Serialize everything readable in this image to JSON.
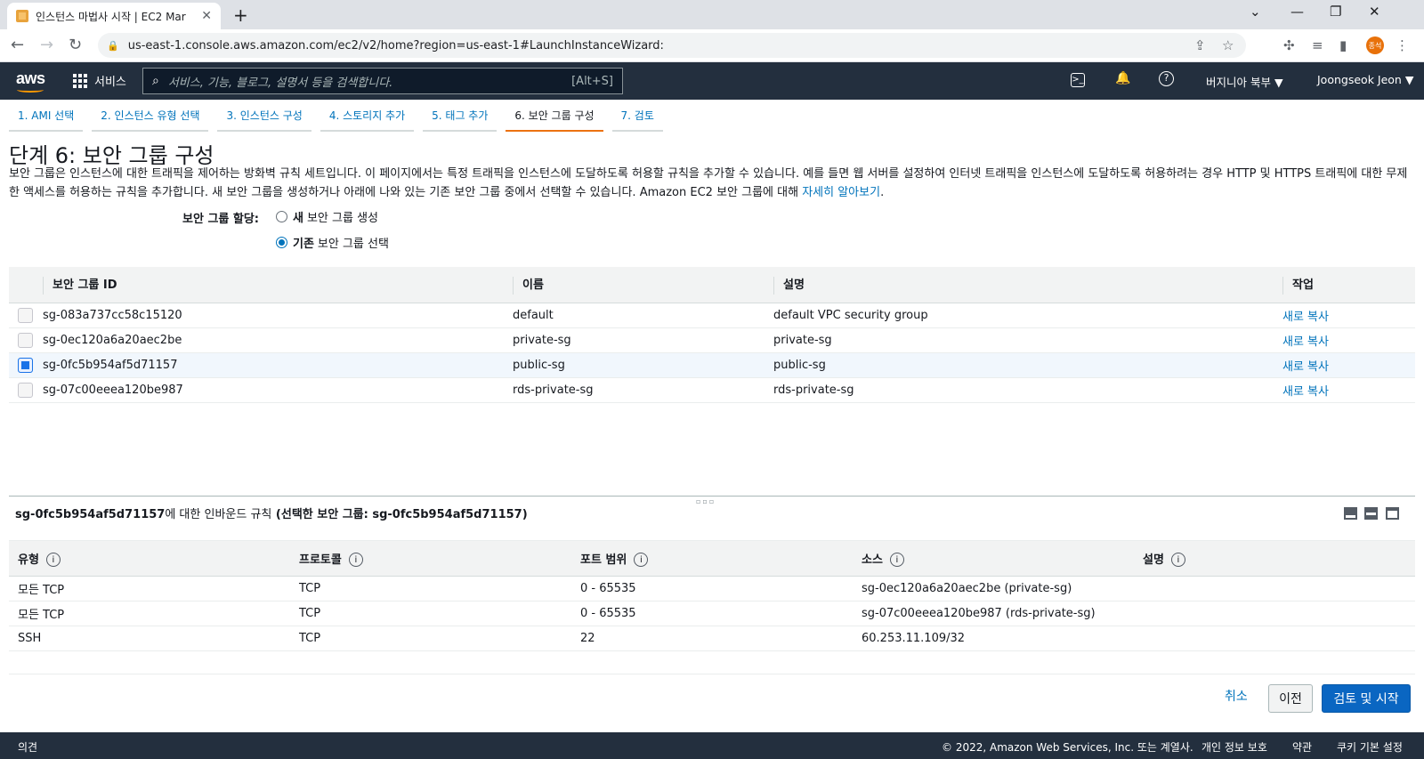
{
  "browser": {
    "tab_title": "인스턴스 마법사 시작 | EC2 Mar",
    "tab_close": "✕",
    "new_tab": "+",
    "url": "us-east-1.console.aws.amazon.com/ec2/v2/home?region=us-east-1#LaunchInstanceWizard:",
    "profile_initials": "종석"
  },
  "aws_header": {
    "logo": "aws",
    "services_label": "서비스",
    "search_placeholder": "서비스, 기능, 블로그, 설명서 등을 검색합니다.",
    "search_shortcut": "[Alt+S]",
    "region": "버지니아 북부 ▼",
    "user": "Joongseok Jeon ▼"
  },
  "wizard_steps": [
    {
      "label": "1. AMI 선택"
    },
    {
      "label": "2. 인스턴스 유형 선택"
    },
    {
      "label": "3. 인스턴스 구성"
    },
    {
      "label": "4. 스토리지 추가"
    },
    {
      "label": "5. 태그 추가"
    },
    {
      "label": "6. 보안 그룹 구성"
    },
    {
      "label": "7. 검토"
    }
  ],
  "page": {
    "title": "단계 6: 보안 그룹 구성",
    "description": "보안 그룹은 인스턴스에 대한 트래픽을 제어하는 방화벽 규칙 세트입니다. 이 페이지에서는 특정 트래픽을 인스턴스에 도달하도록 허용할 규칙을 추가할 수 있습니다. 예를 들면 웹 서버를 설정하여 인터넷 트래픽을 인스턴스에 도달하도록 허용하려는 경우 HTTP 및 HTTPS 트래픽에 대한 무제한 액세스를 허용하는 규칙을 추가합니다. 새 보안 그룹을 생성하거나 아래에 나와 있는 기존 보안 그룹 중에서 선택할 수 있습니다. Amazon EC2 보안 그룹에 대해",
    "learn_more": "자세히 알아보기",
    "learn_more_suffix": ".",
    "assign_label": "보안 그룹 할당:",
    "radio_new_bold": "새",
    "radio_new_rest": "보안 그룹 생성",
    "radio_existing_bold": "기존",
    "radio_existing_rest": "보안 그룹 선택"
  },
  "sg_table": {
    "headers": {
      "id": "보안 그룹 ID",
      "name": "이름",
      "desc": "설명",
      "action": "작업"
    },
    "rows": [
      {
        "id": "sg-083a737cc58c15120",
        "name": "default",
        "desc": "default VPC security group",
        "action": "새로 복사"
      },
      {
        "id": "sg-0ec120a6a20aec2be",
        "name": "private-sg",
        "desc": "private-sg",
        "action": "새로 복사"
      },
      {
        "id": "sg-0fc5b954af5d71157",
        "name": "public-sg",
        "desc": "public-sg",
        "action": "새로 복사"
      },
      {
        "id": "sg-07c00eeea120be987",
        "name": "rds-private-sg",
        "desc": "rds-private-sg",
        "action": "새로 복사"
      }
    ]
  },
  "inbound": {
    "title_id": "sg-0fc5b954af5d71157",
    "title_mid": "에 대한 인바운드 규칙",
    "title_paren": "(선택한 보안 그룹: sg-0fc5b954af5d71157)",
    "headers": {
      "type": "유형",
      "protocol": "프로토콜",
      "port": "포트 범위",
      "source": "소스",
      "desc": "설명"
    },
    "info": "i",
    "rows": [
      {
        "type": "모든 TCP",
        "protocol": "TCP",
        "port": "0 - 65535",
        "source": "sg-0ec120a6a20aec2be (private-sg)"
      },
      {
        "type": "모든 TCP",
        "protocol": "TCP",
        "port": "0 - 65535",
        "source": "sg-07c00eeea120be987 (rds-private-sg)"
      },
      {
        "type": "SSH",
        "protocol": "TCP",
        "port": "22",
        "source": "60.253.11.109/32"
      }
    ]
  },
  "actions": {
    "cancel": "취소",
    "previous": "이전",
    "review_launch": "검토 및 시작"
  },
  "footer": {
    "feedback": "의견",
    "copyright": "© 2022, Amazon Web Services, Inc. 또는 계열사.",
    "privacy": "개인 정보 보호",
    "terms": "약관",
    "cookies": "쿠키 기본 설정"
  }
}
